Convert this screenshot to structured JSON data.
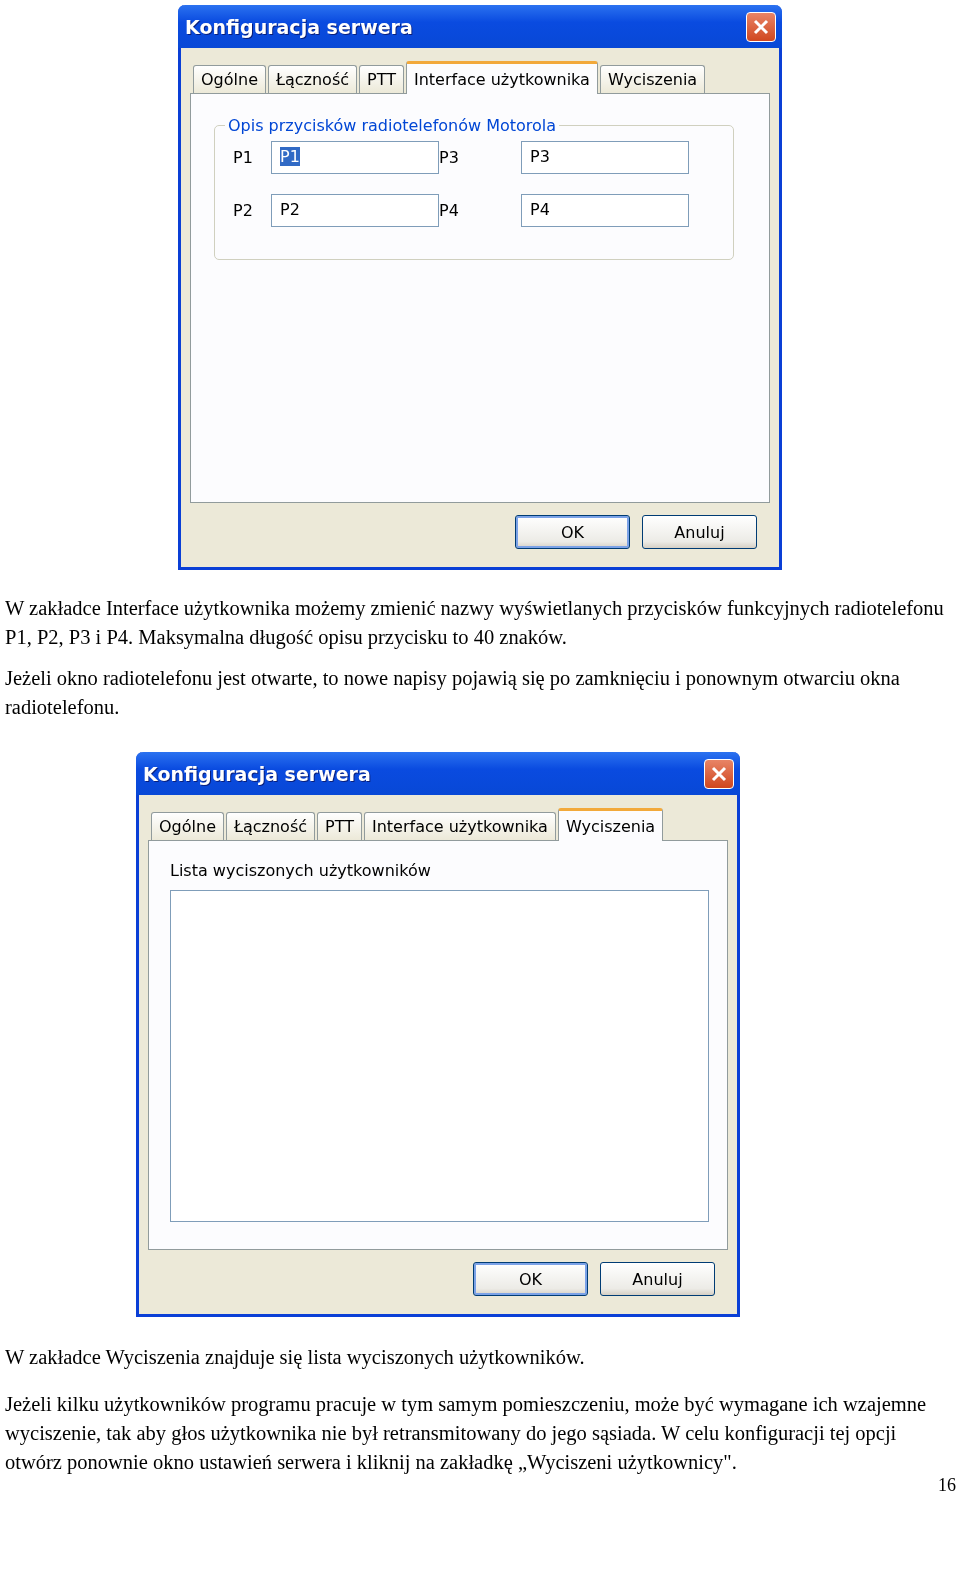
{
  "content": [
    {
      "kind": "dialog",
      "title": "Konfiguracja serwera",
      "tabs": [
        {
          "label": "Ogólne",
          "selected": false
        },
        {
          "label": "Łączność",
          "selected": false
        },
        {
          "label": "PTT",
          "selected": false
        },
        {
          "label": "Interface użytkownika",
          "selected": true
        },
        {
          "label": "Wyciszenia",
          "selected": false
        }
      ],
      "panel": {
        "kind": "fields",
        "group_title": "Opis przycisków radiotelefonów Motorola",
        "fields": [
          {
            "label": "P1",
            "value": "P1",
            "selected": true
          },
          {
            "label": "P3",
            "value": "P3",
            "selected": false
          },
          {
            "label": "P2",
            "value": "P2",
            "selected": false
          },
          {
            "label": "P4",
            "value": "P4",
            "selected": false
          }
        ]
      },
      "buttons": [
        {
          "label": "OK",
          "default": true
        },
        {
          "label": "Anuluj",
          "default": false
        }
      ]
    },
    {
      "kind": "paragraph",
      "text": "W zakładce Interface użytkownika możemy zmienić nazwy wyświetlanych przycisków funkcyjnych radiotelefonu P1, P2, P3 i P4. Maksymalna długość opisu przycisku to 40 znaków."
    },
    {
      "kind": "paragraph",
      "text": "Jeżeli okno radiotelefonu jest otwarte, to nowe napisy pojawią się po zamknięciu i ponownym otwarciu okna radiotelefonu."
    },
    {
      "kind": "dialog",
      "title": "Konfiguracja serwera",
      "tabs": [
        {
          "label": "Ogólne",
          "selected": false
        },
        {
          "label": "Łączność",
          "selected": false
        },
        {
          "label": "PTT",
          "selected": false
        },
        {
          "label": "Interface użytkownika",
          "selected": false
        },
        {
          "label": "Wyciszenia",
          "selected": true
        }
      ],
      "panel": {
        "kind": "list",
        "list_label": "Lista wyciszonych użytkowników"
      },
      "buttons": [
        {
          "label": "OK",
          "default": true
        },
        {
          "label": "Anuluj",
          "default": false
        }
      ]
    },
    {
      "kind": "paragraph",
      "text": "W zakładce Wyciszenia znajduje się lista wyciszonych użytkowników."
    },
    {
      "kind": "paragraph",
      "text": "Jeżeli kilku użytkowników programu pracuje w tym samym pomieszczeniu, może być wymagane ich wzajemne wyciszenie, tak aby głos użytkownika nie był retransmitowany do jego sąsiada. W celu konfiguracji tej opcji otwórz ponownie okno ustawień serwera i kliknij na zakładkę „Wyciszeni użytkownicy\"."
    }
  ],
  "page_number": "16"
}
